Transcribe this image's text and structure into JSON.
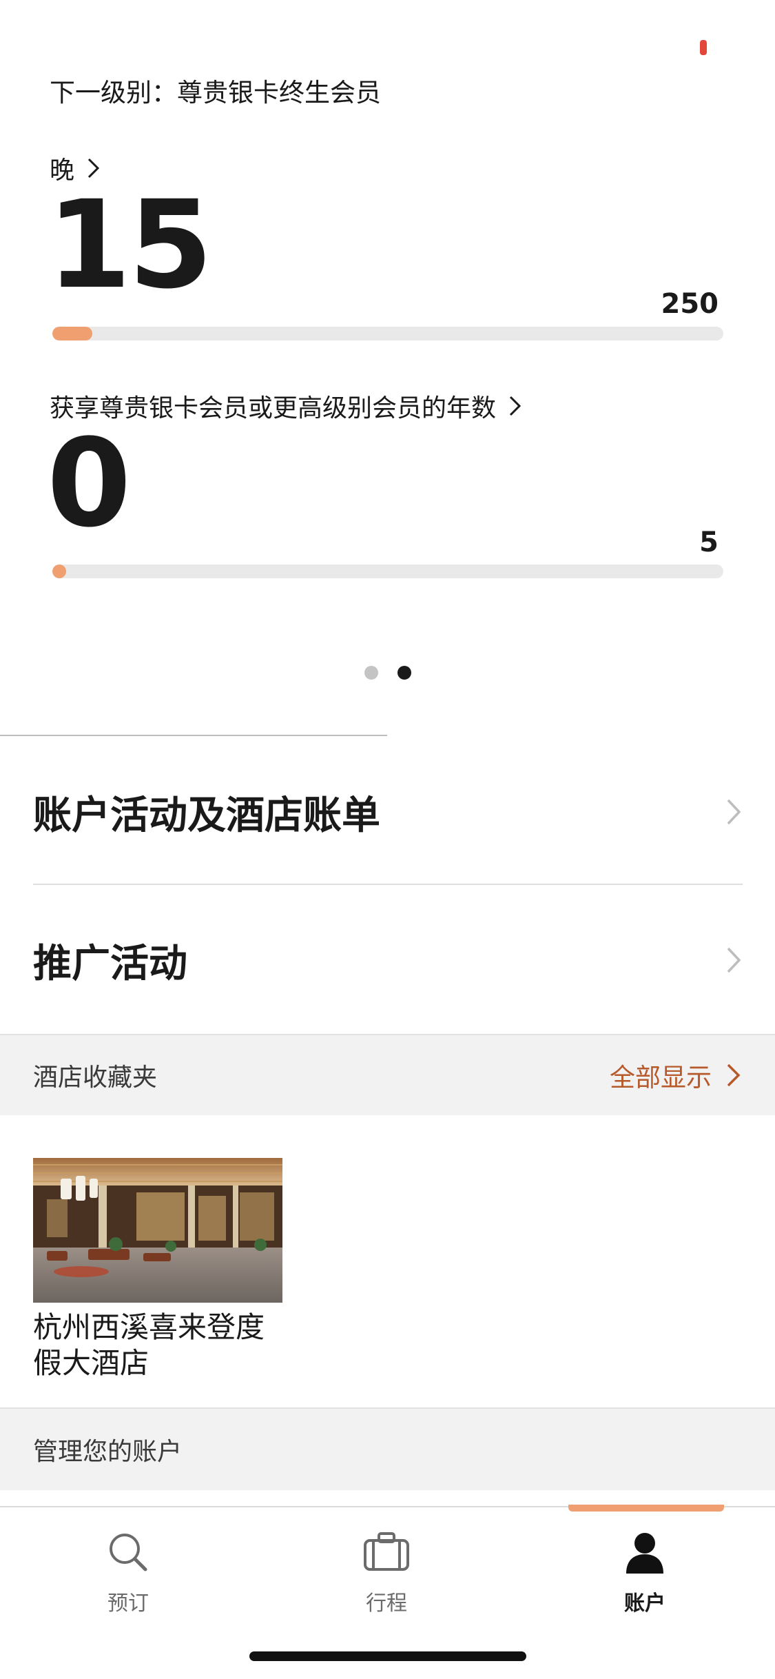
{
  "status": {
    "indicator_color": "#e3473b"
  },
  "tier": {
    "next_tier_label": "下一级别：尊贵银卡终生会员"
  },
  "metrics": [
    {
      "label": "晚",
      "value": "15",
      "target": "250",
      "progress_fraction": 0.06
    },
    {
      "label": "获享尊贵银卡会员或更高级别会员的年数",
      "value": "0",
      "target": "5",
      "progress_fraction": 0.0
    }
  ],
  "pager": {
    "count": 2,
    "active_index": 2
  },
  "menu": {
    "account_activity": "账户活动及酒店账单",
    "promotions": "推广活动"
  },
  "favorites": {
    "title": "酒店收藏夹",
    "show_all": "全部显示",
    "hotels": [
      {
        "name": "杭州西溪喜来登度假大酒店",
        "image": "hotel-lobby-photo"
      }
    ]
  },
  "manage": {
    "title": "管理您的账户"
  },
  "tabs": [
    {
      "label": "预订",
      "icon": "search-icon"
    },
    {
      "label": "行程",
      "icon": "suitcase-icon"
    },
    {
      "label": "账户",
      "icon": "person-icon",
      "active": true
    }
  ],
  "colors": {
    "accent": "#f0a070",
    "link": "#b75a2b",
    "text": "#1a1a1a"
  }
}
